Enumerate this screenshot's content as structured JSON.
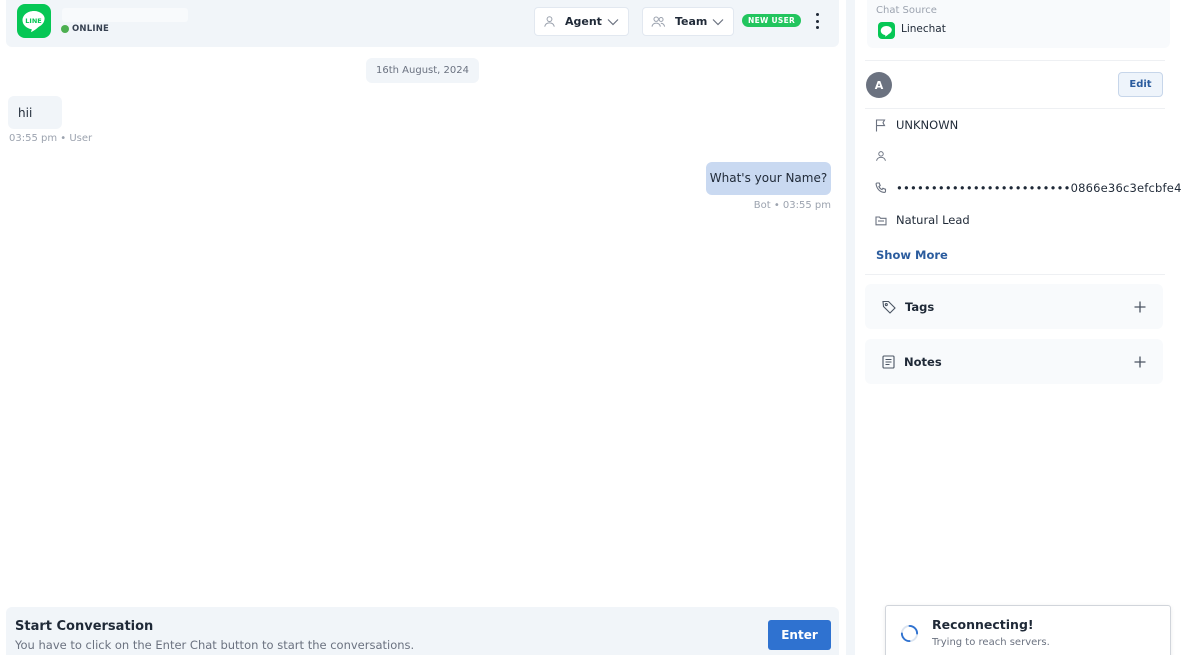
{
  "header": {
    "channel_logo_text": "LINE",
    "status": "ONLINE",
    "agent_label": "Agent",
    "team_label": "Team",
    "badge": "NEW USER",
    "colors": {
      "online": "#4caf50",
      "line_brand": "#06c755",
      "badge": "#22c55e"
    }
  },
  "chat": {
    "date": "16th August, 2024",
    "messages": [
      {
        "sender": "user",
        "text": "hii",
        "meta": "03:55 pm • User"
      },
      {
        "sender": "bot",
        "text": "What's your Name?",
        "meta": "Bot • 03:55 pm"
      }
    ]
  },
  "start_conversation": {
    "title": "Start Conversation",
    "subtitle": "You have to click on the Enter Chat button to start the conversations.",
    "button": "Enter"
  },
  "sidebar": {
    "source_label": "Chat Source",
    "source_name": "Linechat",
    "avatar_initial": "A",
    "edit_label": "Edit",
    "details": {
      "flag": "UNKNOWN",
      "name": "",
      "phone": "•••••••••••••••••••••••••0866e36c3efcbfe4",
      "lead": "Natural Lead"
    },
    "show_more": "Show More",
    "tags_label": "Tags",
    "notes_label": "Notes"
  },
  "toast": {
    "title": "Reconnecting!",
    "subtitle": "Trying to reach servers."
  },
  "icons": [
    "line-logo-icon",
    "user-icon",
    "users-icon",
    "chevron-down-icon",
    "kebab-menu-icon",
    "flag-icon",
    "phone-icon",
    "folder-icon",
    "tag-icon",
    "notes-icon",
    "plus-icon",
    "spinner-icon"
  ]
}
